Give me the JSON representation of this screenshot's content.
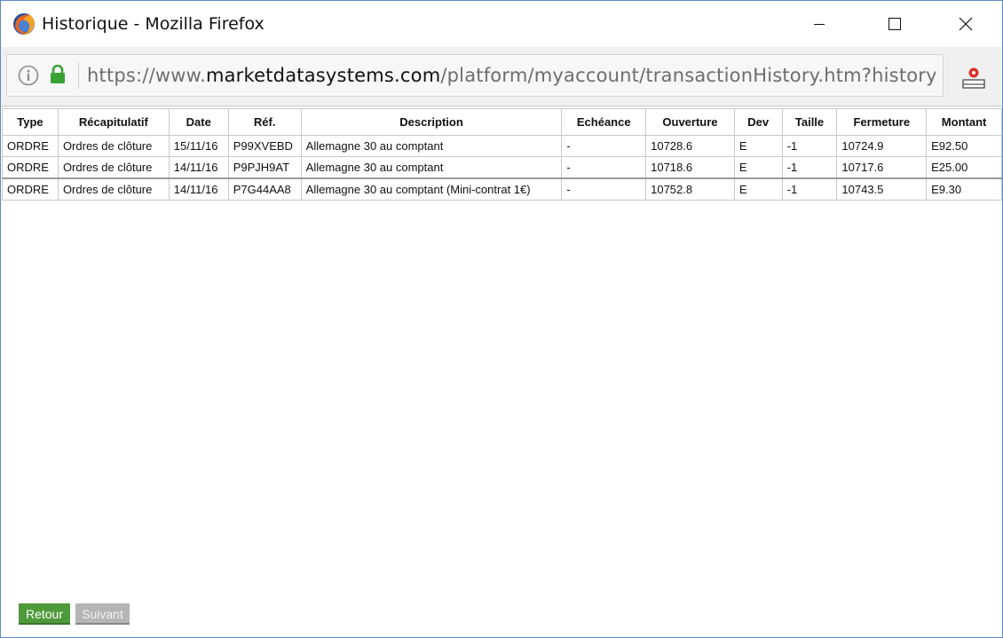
{
  "window": {
    "title": "Historique - Mozilla Firefox"
  },
  "urlbar": {
    "scheme": "https://www.",
    "domain": "marketdatasystems.com",
    "path": "/platform/myaccount/transactionHistory.htm?history"
  },
  "table": {
    "headers": [
      "Type",
      "Récapitulatif",
      "Date",
      "Réf.",
      "Description",
      "Echéance",
      "Ouverture",
      "Dev",
      "Taille",
      "Fermeture",
      "Montant"
    ],
    "rows": [
      [
        "ORDRE",
        "Ordres de clôture",
        "15/11/16",
        "P99XVEBD",
        "Allemagne 30 au comptant",
        "-",
        "10728.6",
        "E",
        "-1",
        "10724.9",
        "E92.50"
      ],
      [
        "ORDRE",
        "Ordres de clôture",
        "14/11/16",
        "P9PJH9AT",
        "Allemagne 30 au comptant",
        "-",
        "10718.6",
        "E",
        "-1",
        "10717.6",
        "E25.00"
      ],
      [
        "ORDRE",
        "Ordres de clôture",
        "14/11/16",
        "P7G44AA8",
        "Allemagne 30 au comptant (Mini-contrat 1€)",
        "-",
        "10752.8",
        "E",
        "-1",
        "10743.5",
        "E9.30"
      ]
    ]
  },
  "buttons": {
    "back": "Retour",
    "next": "Suivant"
  },
  "colors": {
    "back_button": "#4e9a3a",
    "next_button_disabled": "#b5b5b5",
    "lock_green": "#38a334"
  },
  "icons": [
    "firefox-logo",
    "info-icon",
    "lock-icon",
    "screenshot-icon",
    "minimize-icon",
    "maximize-icon",
    "close-icon"
  ]
}
